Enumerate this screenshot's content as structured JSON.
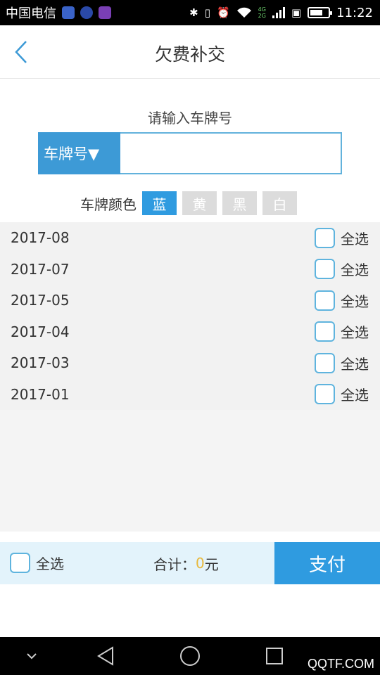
{
  "status_bar": {
    "carrier": "中国电信",
    "network_top": "4G",
    "network_bottom": "2G",
    "time": "11:22",
    "battery_level": 0.7
  },
  "header": {
    "title": "欠费补交",
    "back_icon": "chevron-left-icon"
  },
  "plate": {
    "prompt": "请输入车牌号",
    "select_label": "车牌号▼",
    "input_value": "",
    "input_placeholder": ""
  },
  "plate_color": {
    "label": "车牌颜色",
    "options": [
      "蓝",
      "黄",
      "黑",
      "白"
    ],
    "selected": "蓝"
  },
  "months": [
    {
      "month": "2017-08",
      "select_label": "全选",
      "checked": false
    },
    {
      "month": "2017-07",
      "select_label": "全选",
      "checked": false
    },
    {
      "month": "2017-05",
      "select_label": "全选",
      "checked": false
    },
    {
      "month": "2017-04",
      "select_label": "全选",
      "checked": false
    },
    {
      "month": "2017-03",
      "select_label": "全选",
      "checked": false
    },
    {
      "month": "2017-01",
      "select_label": "全选",
      "checked": false
    }
  ],
  "footer": {
    "select_all_label": "全选",
    "total_label": "合计：",
    "total_amount": "0",
    "currency": "元",
    "pay_label": "支付"
  },
  "watermark": "QQTF.COM",
  "colors": {
    "accent": "#2f9be0",
    "select_bg": "#3d9ad6",
    "amount": "#e8b83a",
    "footer_bg": "#e3f3fb"
  }
}
